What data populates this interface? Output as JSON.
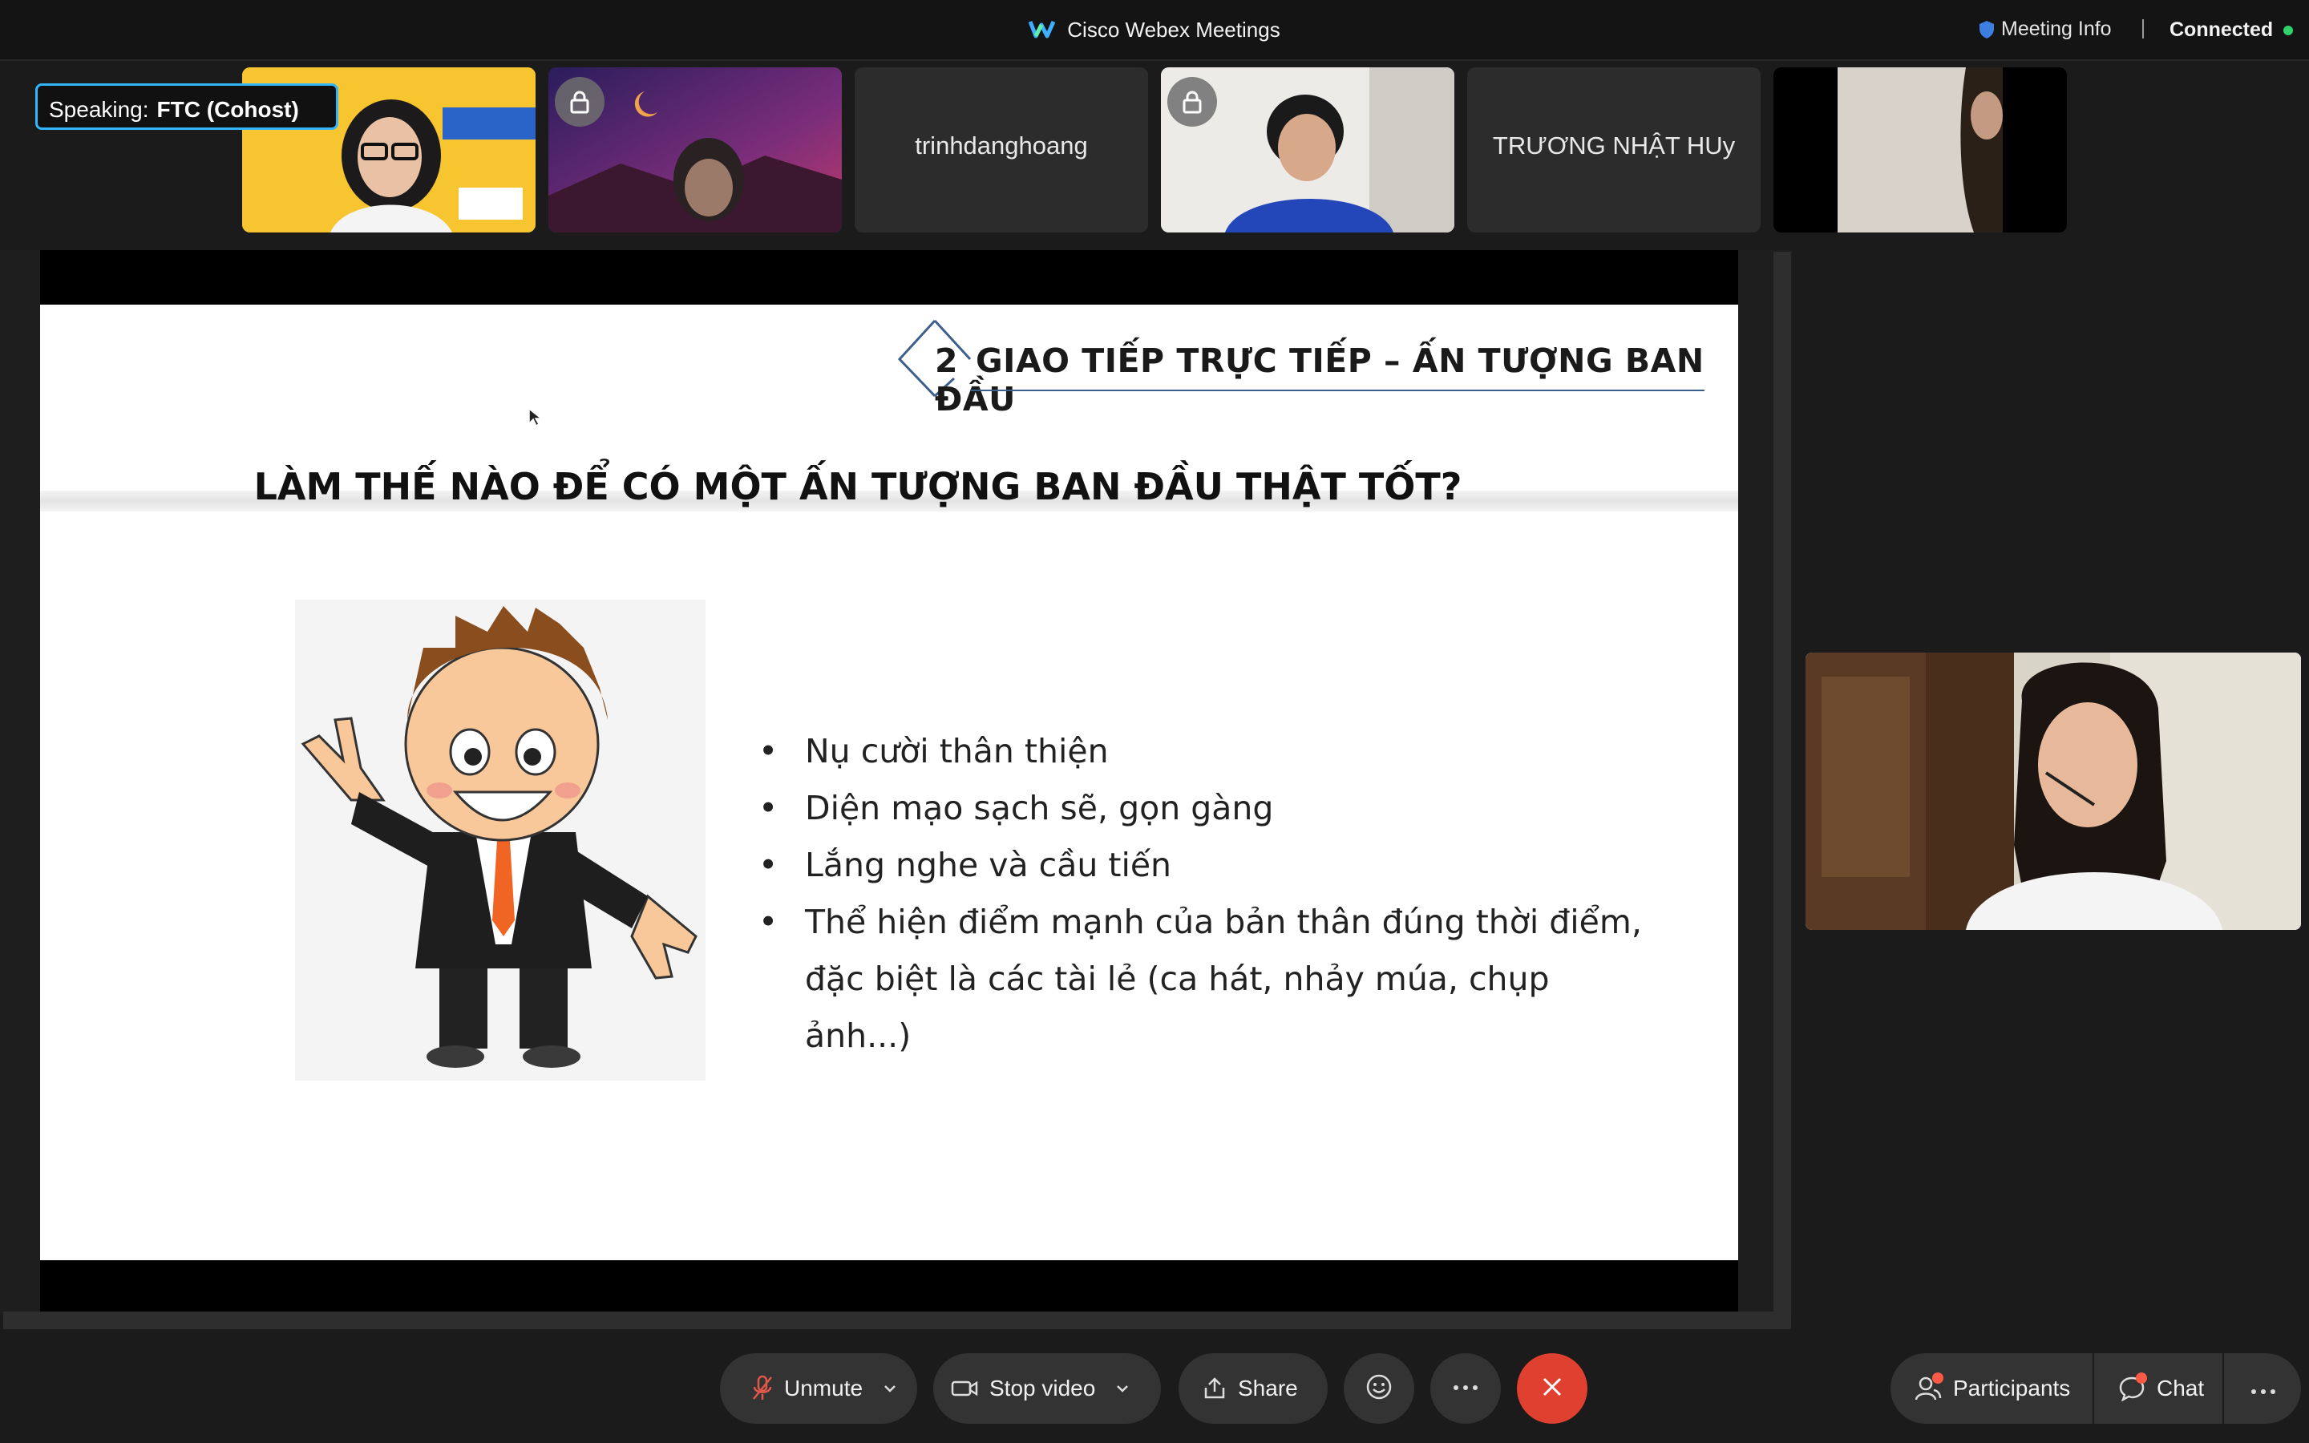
{
  "window": {
    "title": "Cisco Webex Meetings",
    "meeting_info_label": "Meeting Info",
    "connection_status": "Connected"
  },
  "speaking": {
    "prefix": "Speaking:",
    "name": "FTC (Cohost)"
  },
  "participants": [
    {
      "type": "video"
    },
    {
      "type": "video",
      "locked": true
    },
    {
      "type": "name",
      "name": "trinhdanghoang"
    },
    {
      "type": "video",
      "locked": true
    },
    {
      "type": "name",
      "name": "TRƯƠNG NHẬT HUy"
    },
    {
      "type": "video"
    }
  ],
  "slide": {
    "section_number": "2",
    "section_title": "GIAO TIẾP TRỰC TIẾP – ẤN TƯỢNG BAN ĐẦU",
    "question": "LÀM THẾ NÀO ĐỂ CÓ MỘT ẤN TƯỢNG BAN ĐẦU THẬT TỐT?",
    "bullets": [
      "Nụ cười thân thiện",
      "Diện mạo sạch sẽ, gọn gàng",
      "Lắng nghe và cầu tiến",
      "Thể hiện điểm mạnh của bản thân đúng thời điểm, đặc biệt là các tài lẻ (ca hát, nhảy múa, chụp ảnh...)"
    ]
  },
  "controls": {
    "unmute": "Unmute",
    "stop_video": "Stop video",
    "share": "Share",
    "participants": "Participants",
    "chat": "Chat"
  },
  "colors": {
    "leave": "#e0402f",
    "accent_border": "#33b5ff",
    "connected": "#2fd36b"
  }
}
